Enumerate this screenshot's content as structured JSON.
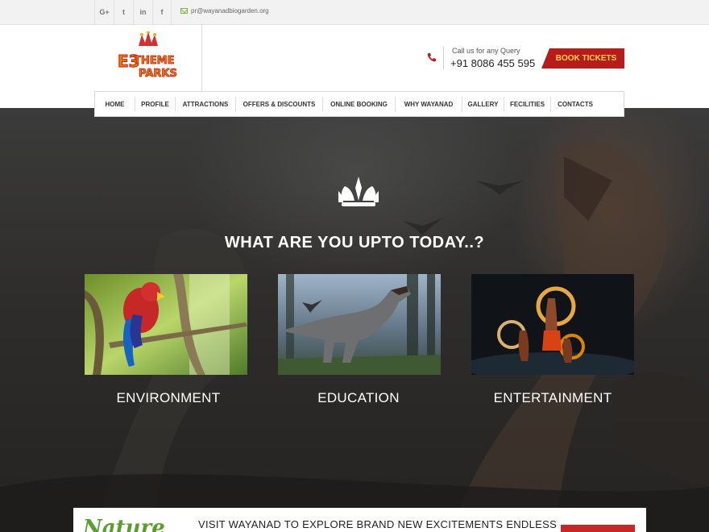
{
  "topbar": {
    "social": [
      {
        "name": "google-plus-icon",
        "glyph": "G+"
      },
      {
        "name": "twitter-icon",
        "glyph": "t"
      },
      {
        "name": "linkedin-icon",
        "glyph": "in"
      },
      {
        "name": "facebook-icon",
        "glyph": "f"
      }
    ],
    "email": "pr@wayanadbiogarden.org"
  },
  "header": {
    "logo_text": [
      "E3",
      "THEME",
      "PARKS"
    ],
    "contact_label": "Call us for any Query",
    "phone": "+91 8086 455 595",
    "book_label": "BOOK TICKETS"
  },
  "nav": [
    "HOME",
    "PROFILE",
    "ATTRACTIONS",
    "OFFERS & DISCOUNTS",
    "ONLINE BOOKING",
    "WHY WAYANAD",
    "GALLERY",
    "FECILITIES",
    "CONTACTS"
  ],
  "hero": {
    "title": "WHAT ARE YOU UPTO TODAY..?",
    "cards": [
      "ENVIRONMENT",
      "EDUCATION",
      "ENTERTAINMENT"
    ]
  },
  "banner": {
    "script_text": "Nature",
    "text": "VISIT WAYANAD TO EXPLORE BRAND NEW EXCITEMENTS ENDLESS"
  },
  "colors": {
    "accent": "#b71c1c",
    "button_text": "#ffd54f",
    "green": "#7cb342"
  }
}
